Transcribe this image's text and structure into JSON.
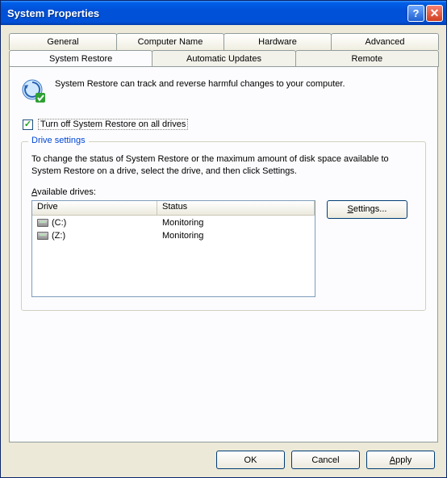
{
  "window": {
    "title": "System Properties"
  },
  "tabs": {
    "row1": [
      "General",
      "Computer Name",
      "Hardware",
      "Advanced"
    ],
    "row2": [
      "System Restore",
      "Automatic Updates",
      "Remote"
    ],
    "active": "System Restore"
  },
  "intro": {
    "text": "System Restore can track and reverse harmful changes to your computer."
  },
  "checkbox": {
    "checked": true,
    "label_pre": "T",
    "label_rest": "urn off System Restore on all drives"
  },
  "group": {
    "title": "Drive settings",
    "desc": "To change the status of System Restore or the maximum amount of disk space available to System Restore on a drive, select the drive, and then click Settings.",
    "avail_pre": "A",
    "avail_rest": "vailable drives:",
    "columns": {
      "drive": "Drive",
      "status": "Status"
    },
    "drives": [
      {
        "name": "(C:)",
        "status": "Monitoring"
      },
      {
        "name": "(Z:)",
        "status": "Monitoring"
      }
    ],
    "settings_btn_pre": "S",
    "settings_btn_rest": "ettings..."
  },
  "buttons": {
    "ok": "OK",
    "cancel": "Cancel",
    "apply_pre": "A",
    "apply_rest": "pply"
  }
}
